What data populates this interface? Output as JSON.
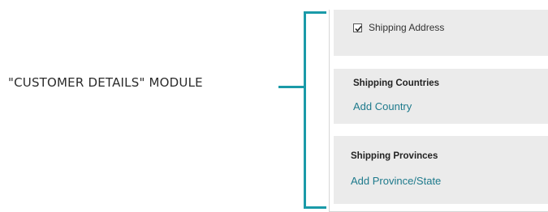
{
  "annotation": {
    "module_label": "\"CUSTOMER DETAILS\" MODULE",
    "accent_color": "#1a9aa8"
  },
  "panel": {
    "shipping_address": {
      "label": "Shipping Address",
      "checked": true
    },
    "shipping_countries": {
      "title": "Shipping Countries",
      "link": "Add Country"
    },
    "shipping_provinces": {
      "title": "Shipping Provinces",
      "link": "Add Province/State"
    },
    "link_color": "#1e7a8c",
    "section_background": "#ebebeb"
  }
}
